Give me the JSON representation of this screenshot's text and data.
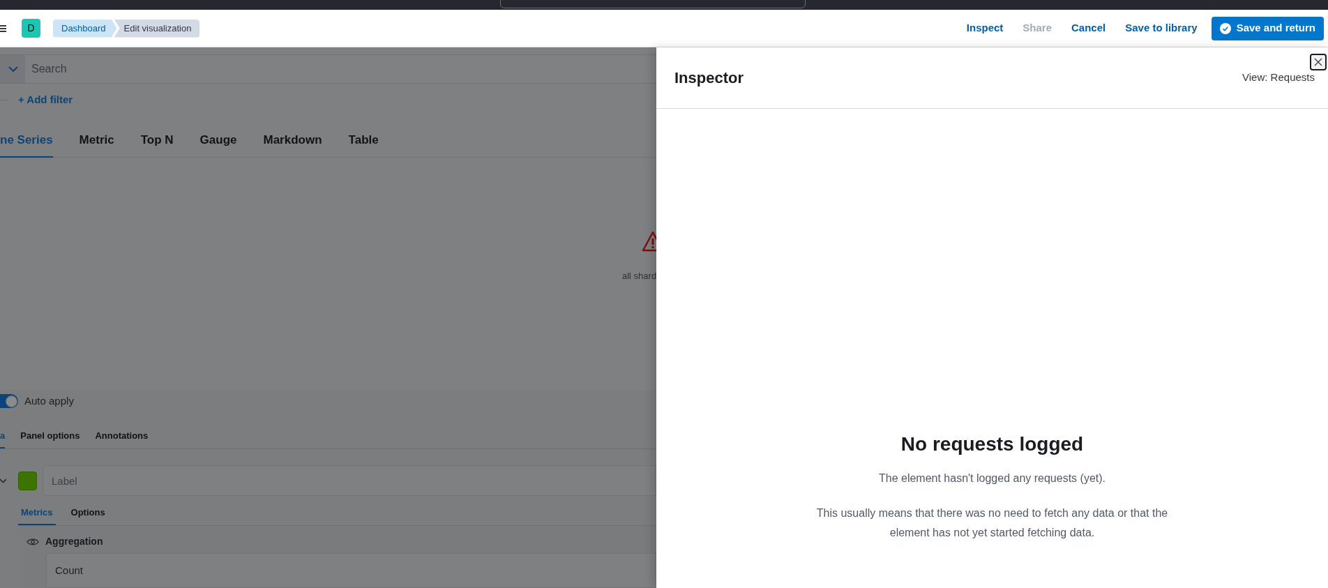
{
  "header": {
    "app_badge": "D",
    "breadcrumbs": [
      {
        "label": "Dashboard",
        "selected": false
      },
      {
        "label": "Edit visualization",
        "selected": true
      }
    ],
    "actions": [
      {
        "label": "Inspect",
        "disabled": false
      },
      {
        "label": "Share",
        "disabled": true
      },
      {
        "label": "Cancel",
        "disabled": false
      },
      {
        "label": "Save to library",
        "disabled": false
      }
    ],
    "primary_button": "Save and return"
  },
  "editor": {
    "search": {
      "placeholder": "Search"
    },
    "add_filter": "+ Add filter",
    "tabs": [
      {
        "label": "ne Series",
        "selected": true
      },
      {
        "label": "Metric",
        "selected": false
      },
      {
        "label": "Top N",
        "selected": false
      },
      {
        "label": "Gauge",
        "selected": false
      },
      {
        "label": "Markdown",
        "selected": false
      },
      {
        "label": "Table",
        "selected": false
      }
    ],
    "error_text": "all shard",
    "auto_apply": {
      "label": "Auto apply",
      "on": true
    },
    "panel_tabs": [
      {
        "label": "a",
        "selected": true
      },
      {
        "label": "Panel options",
        "selected": false
      },
      {
        "label": "Annotations",
        "selected": false
      }
    ],
    "series": {
      "label_placeholder": "Label",
      "tabs": [
        {
          "label": "Metrics",
          "selected": true
        },
        {
          "label": "Options",
          "selected": false
        }
      ],
      "aggregation": {
        "label": "Aggregation",
        "value": "Count"
      }
    }
  },
  "inspector": {
    "title": "Inspector",
    "view": "View: Requests",
    "empty_title": "No requests logged",
    "empty_body": [
      "The element hasn't logged any requests (yet).",
      "This usually means that there was no need to fetch any data or that the element has not yet started fetching data."
    ]
  }
}
